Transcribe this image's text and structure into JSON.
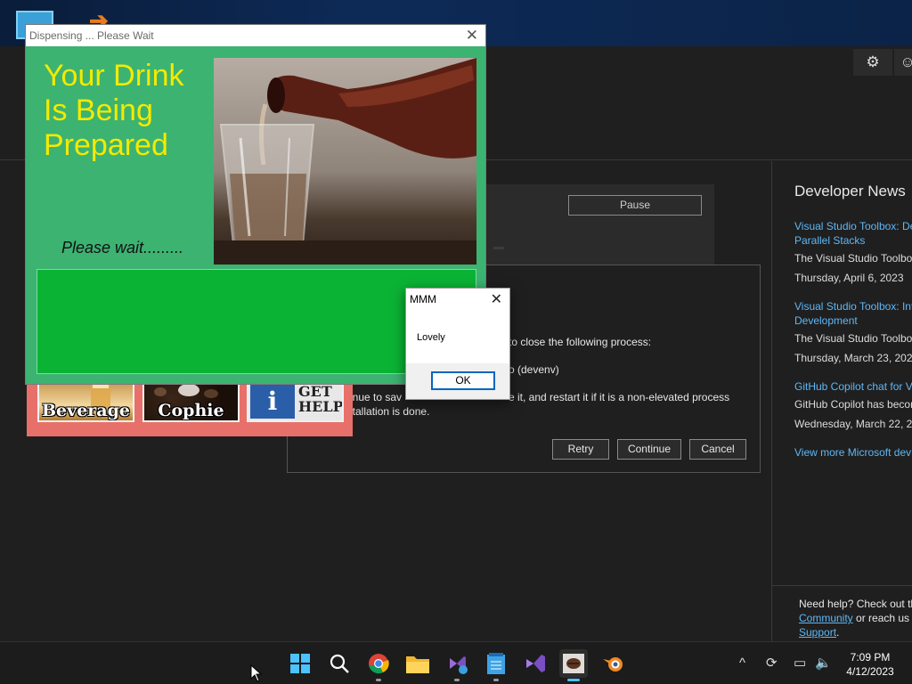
{
  "vs_app": {
    "pause_label": "Pause",
    "process": {
      "line1": "to close the following process:",
      "line2": "o (devenv)",
      "line3": "ntinue to sav",
      "line3b": "e it, and restart it if it is a non-elevated process",
      "line4": "nstallation is done.",
      "retry_label": "Retry",
      "continue_label": "Continue",
      "cancel_label": "Cancel"
    },
    "news": {
      "title": "Developer News",
      "items": [
        {
          "link_line1": "Visual Studio Toolbox: De",
          "link_line2": "Parallel Stacks",
          "text": "The Visual Studio Toolbox",
          "date": "Thursday, April 6, 2023"
        },
        {
          "link_line1": "Visual Studio Toolbox: Int",
          "link_line2": "Development",
          "text": "The Visual Studio Toolbox",
          "date": "Thursday, March 23, 2023"
        },
        {
          "link_line1": "GitHub Copilot chat for V",
          "link_line2": "",
          "text": "GitHub Copilot has becon",
          "date": "Wednesday, March 22, 20"
        }
      ],
      "more_link": "View more Microsoft dev"
    },
    "help": {
      "line1": "Need help? Check out th",
      "community_link": "Community",
      "line2_rest": " or reach us",
      "support_link": "Support",
      "period": "."
    }
  },
  "dispensing_window": {
    "title": "Dispensing ... Please Wait",
    "close_glyph": "✕",
    "heading_line1": "Your Drink",
    "heading_line2": "Is Being",
    "heading_line3": "Prepared",
    "please_wait": "Please wait.........",
    "tiles": {
      "beverage": "Beverage",
      "cophie": "Cophie",
      "help_glyph": "i",
      "help_line1": "GET",
      "help_line2": "HELP"
    }
  },
  "mmm_dialog": {
    "title": "MMM",
    "close_glyph": "✕",
    "message": "Lovely",
    "ok_label": "OK"
  },
  "taskbar": {
    "time": "7:09 PM",
    "date": "4/12/2023",
    "icons": [
      "start-icon",
      "search-icon",
      "chrome-icon",
      "file-explorer-icon",
      "visual-studio-installer-icon",
      "notepad-icon",
      "visual-studio-icon",
      "coffee-app-icon",
      "blender-icon"
    ],
    "active_icon": "coffee-app-icon"
  },
  "colors": {
    "disp_green": "#3cb371",
    "progress_green": "#0bb335",
    "heading_yellow": "#f4ea00",
    "tile_back": "#e8706a",
    "link_blue": "#5eb7f7",
    "accent_blue": "#4cc2ff"
  }
}
